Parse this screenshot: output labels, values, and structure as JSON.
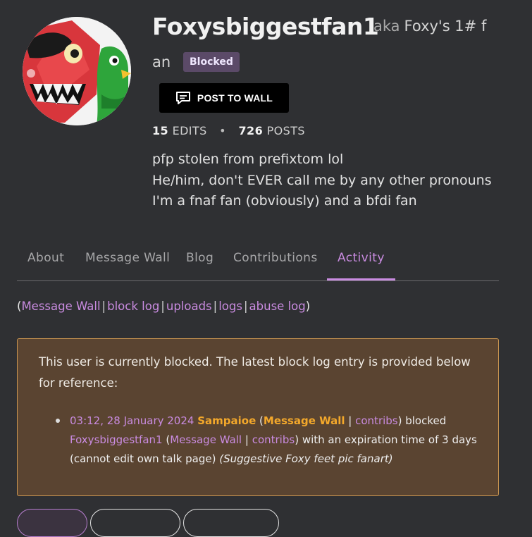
{
  "profile": {
    "username": "Foxysbiggestfan1",
    "aka_label": "aka",
    "nickname_part1": "Foxy's 1# f",
    "nickname_part2": "an",
    "badge": "Blocked",
    "post_button": "POST TO WALL",
    "edits_count": "15",
    "edits_label": "EDITS",
    "posts_count": "726",
    "posts_label": "POSTS",
    "bio_lines": [
      "pfp stolen from prefixtom lol",
      "He/him, don't EVER call me by any other pronouns",
      "I'm a fnaf fan (obviously) and a bfdi fan"
    ]
  },
  "tabs": [
    "About",
    "Message Wall",
    "Blog",
    "Contributions",
    "Activity"
  ],
  "active_tab": "Activity",
  "links": [
    "Message Wall",
    "block log",
    "uploads",
    "logs",
    "abuse log"
  ],
  "block_notice": {
    "text": "This user is currently blocked. The latest block log entry is provided below for reference:",
    "entry": {
      "timestamp": "03:12, 28 January 2024",
      "blocker": "Sampaioe",
      "blocker_wall": "Message Wall",
      "blocker_contribs": "contribs",
      "action": "blocked",
      "target": "Foxysbiggestfan1",
      "target_wall": "Message Wall",
      "target_contribs": "contribs",
      "expiry_text": "with an expiration time of 3 days",
      "restriction": "(cannot edit own talk page)",
      "reason": "(Suggestive Foxy feet pic fanart)"
    }
  },
  "colors": {
    "background": "#2f3033",
    "accent": "#c98be0",
    "notice_bg": "#5a4431",
    "notice_border": "#c89450",
    "highlight": "#f3a82b"
  },
  "icons": [
    "speech-bubble-icon"
  ]
}
